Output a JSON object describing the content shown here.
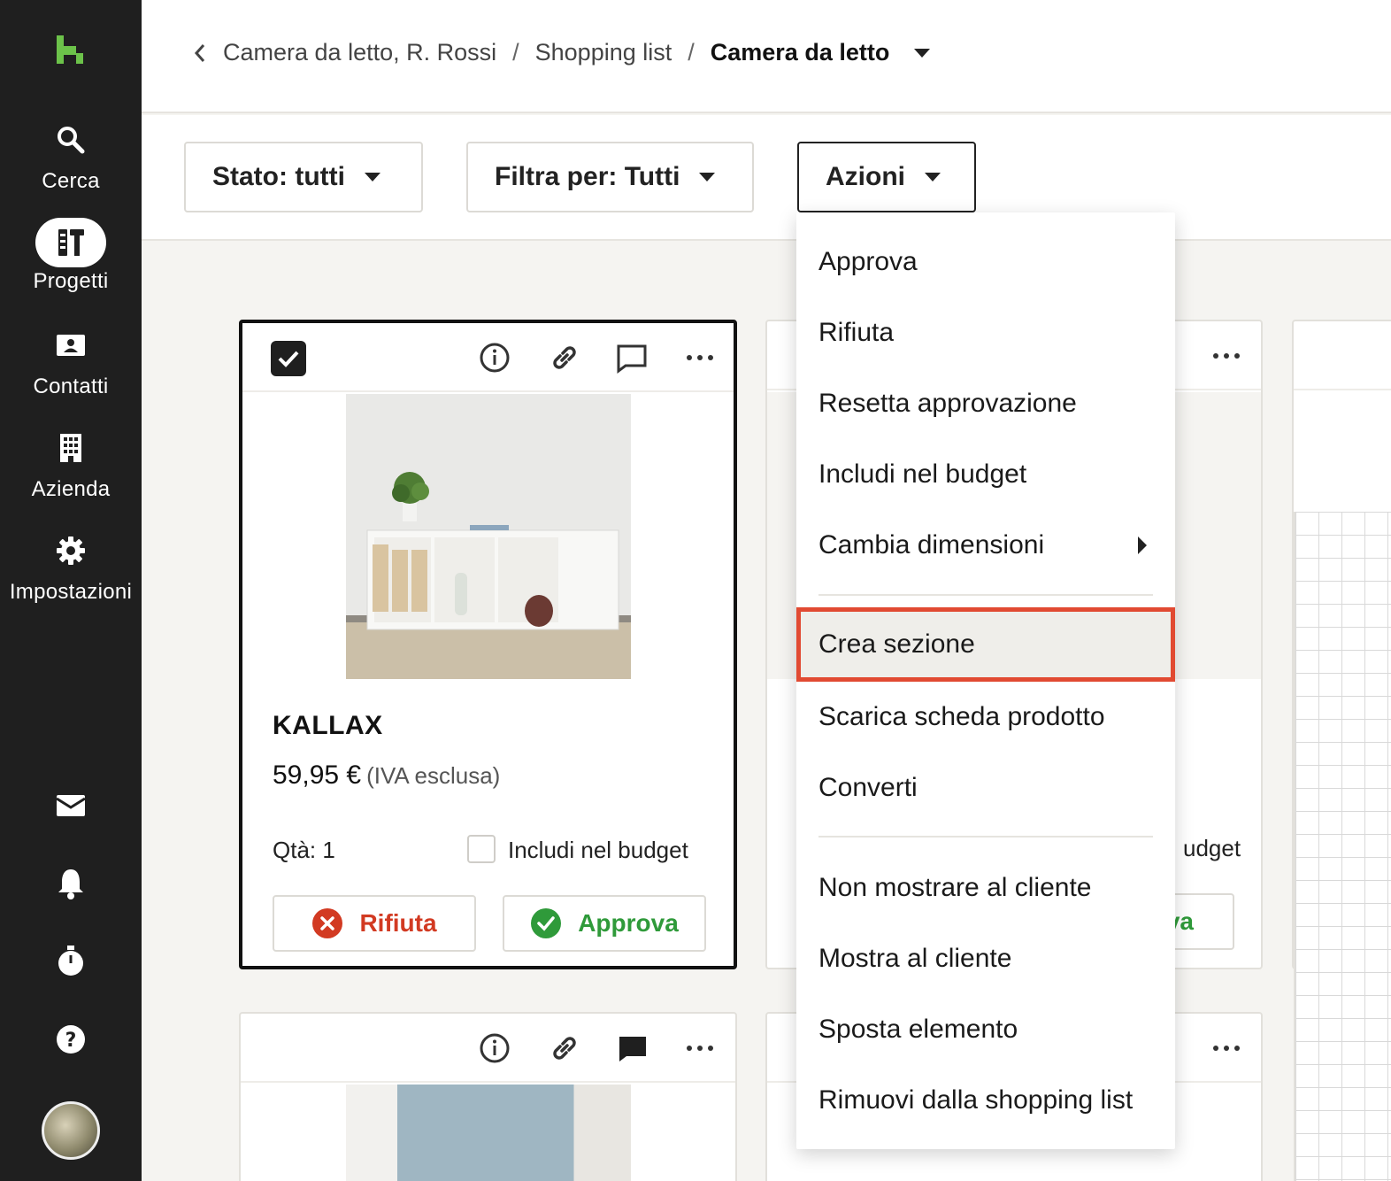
{
  "sidebar": {
    "nav": [
      {
        "label": "Cerca",
        "icon": "search-icon"
      },
      {
        "label": "Progetti",
        "icon": "projects-icon"
      },
      {
        "label": "Contatti",
        "icon": "contacts-icon"
      },
      {
        "label": "Azienda",
        "icon": "building-icon"
      },
      {
        "label": "Impostazioni",
        "icon": "gear-icon"
      }
    ],
    "bottom_icons": [
      "mail-icon",
      "bell-icon",
      "timer-icon",
      "help-icon"
    ],
    "brand_color": "#6cc24a"
  },
  "breadcrumb": {
    "items": [
      "Camera da letto, R. Rossi",
      "Shopping list"
    ],
    "separator": "/",
    "current": "Camera da letto"
  },
  "toolbar": {
    "status_filter": "Stato: tutti",
    "filter_by": "Filtra per: Tutti",
    "actions": "Azioni"
  },
  "card1": {
    "title": "KALLAX",
    "price": "59,95 €",
    "vat_note": "(IVA esclusa)",
    "qty": "Qtà: 1",
    "budget_label": "Includi nel budget",
    "reject_label": "Rifiuta",
    "approve_label": "Approva"
  },
  "card2": {
    "budget_label_partial": "udget",
    "approve_partial": "va"
  },
  "menu": {
    "items": [
      "Approva",
      "Rifiuta",
      "Resetta approvazione",
      "Includi nel budget",
      "Cambia dimensioni",
      "Crea sezione",
      "Scarica scheda prodotto",
      "Converti",
      "Non mostrare al cliente",
      "Mostra al cliente",
      "Sposta elemento",
      "Rimuovi dalla shopping list"
    ],
    "highlighted": "Crea sezione",
    "highlight_color": "#e14a32"
  }
}
